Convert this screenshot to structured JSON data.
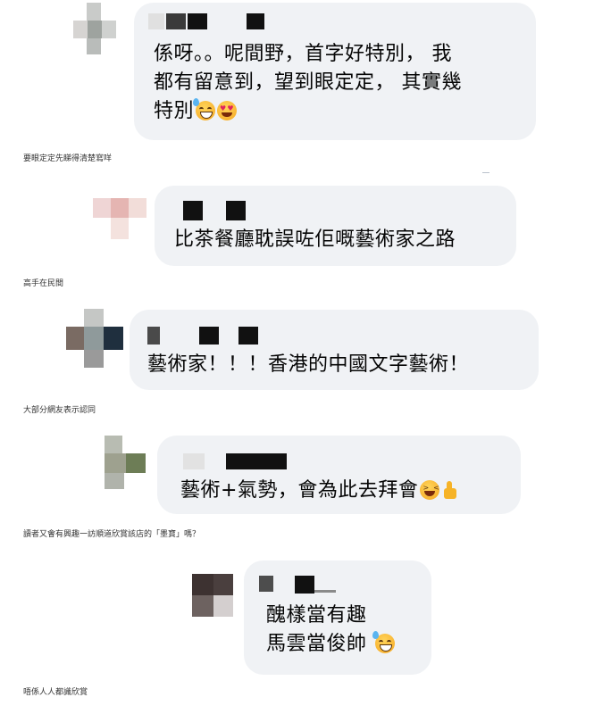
{
  "comments": [
    {
      "message_lines": [
        "係呀。。呢間野，首字好特別， 我",
        "都有留意到，望到眼定定， 其實幾",
        "特別"
      ],
      "emojis": [
        "grinning-sweat-emoji",
        "heart-eyes-emoji"
      ],
      "caption": "要眼定定先睇得清楚寫咩"
    },
    {
      "message_lines": [
        "比茶餐廳耽誤咗佢嘅藝術家之路"
      ],
      "emojis": [],
      "caption": "高手在民間"
    },
    {
      "message_lines": [
        "藝術家！！！香港的中國文字藝術！"
      ],
      "emojis": [],
      "caption": "大部分網友表示認同"
    },
    {
      "message_lines": [
        "藝術+氣勢，會為此去拜會"
      ],
      "emojis": [
        "laughing-emoji",
        "thumbs-up-emoji"
      ],
      "caption": "讀者又會有興趣一訪順道欣賞該店的「墨寶」嗎？"
    },
    {
      "message_lines": [
        "醜樣當有趣",
        "馬雲當俊帥"
      ],
      "emojis": [
        "grinning-sweat-emoji"
      ],
      "caption": "唔係人人都識欣賞"
    }
  ],
  "colors": {
    "bubble": "#f0f2f5",
    "text": "#050505",
    "caption": "#333333"
  }
}
